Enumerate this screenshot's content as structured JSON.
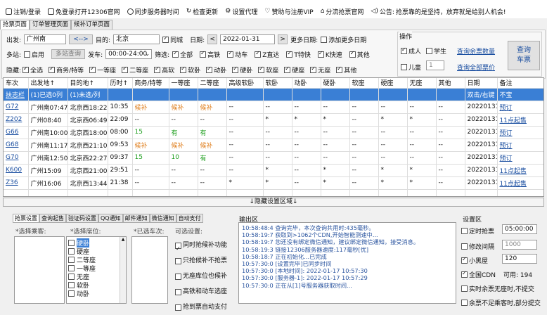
{
  "toolbar": {
    "items": [
      {
        "label": "注销/登录",
        "icon": "screen-icon"
      },
      {
        "label": "免登录打开12306官网",
        "icon": "monitor-icon"
      },
      {
        "label": "同步服务器时间",
        "icon": "clock-icon"
      },
      {
        "label": "检查更新",
        "icon": "refresh-icon"
      },
      {
        "label": "设置代理",
        "icon": "gear-icon"
      },
      {
        "label": "赞助与注册VIP",
        "icon": "heart-icon"
      },
      {
        "label": "分流抢票官网",
        "icon": "home-icon"
      }
    ],
    "notice_label": "公告:",
    "notice_text": "抢票靠的是坚持，放弃就是给别人机会!"
  },
  "tabs": [
    "抢票页面",
    "订单管理页面",
    "候补订单页面"
  ],
  "query": {
    "from_label": "出发:",
    "from": "广州南",
    "swap": "<-->",
    "to_label": "目的:",
    "to": "北京",
    "same_city": "同城",
    "date_label": "日期:",
    "date": "2022-01-31",
    "prev": "<",
    "next": ">",
    "more_dates": "更多日期:",
    "add_more_dates": "添加更多日期",
    "multi_station": "多站:",
    "enable": "启用",
    "multi_query": "多站查询",
    "depart_label": "发车:",
    "depart_time": "00:00-24:00",
    "filter_label": "筛选:",
    "filters": [
      "全部",
      "高铁",
      "动车",
      "Z直达",
      "T特快",
      "K快速",
      "其他"
    ],
    "hide_label": "隐藏:",
    "hide_items": [
      "全选",
      "商务/特等",
      "一等座",
      "二等座",
      "高软",
      "软卧",
      "动卧",
      "硬卧",
      "软座",
      "硬座",
      "无座",
      "其他"
    ]
  },
  "ops": {
    "title": "操作",
    "adult": "成人",
    "student": "学生",
    "child": "儿童",
    "child_count": "1",
    "query_remain": "查询余票数量",
    "query_all": "查询全部票价",
    "search_btn_1": "查询",
    "search_btn_2": "车票"
  },
  "table": {
    "headers": [
      "车次",
      "出发地↑",
      "目的地↑",
      "历时↑",
      "商务/特等",
      "一等座",
      "二等座",
      "高级软卧",
      "软卧",
      "动卧",
      "硬卧",
      "软座",
      "硬座",
      "无座",
      "其他",
      "日期",
      "备注"
    ],
    "select_row": {
      "c0": "扶志栏",
      "c1": "(1)已选0列",
      "c2": "(1)未选/列",
      "c15": "双击/右键",
      "c16": "不宝"
    },
    "rows": [
      {
        "c": [
          "G72",
          "广州南07:47",
          "北京西18:22",
          "10:35",
          "候补",
          "候补",
          "候补",
          "--",
          "--",
          "--",
          "--",
          "--",
          "--",
          "--",
          "--",
          "20220131",
          "预订"
        ],
        "cls": [
          "lnk",
          "",
          "",
          "",
          "orange",
          "orange",
          "orange",
          "",
          "",
          "",
          "",
          "",
          "",
          "",
          "",
          "",
          "lnk"
        ]
      },
      {
        "c": [
          "Z202",
          "广州08:40",
          "北京西06:49",
          "22:09",
          "--",
          "--",
          "--",
          "--",
          "*",
          "*",
          "*",
          "--",
          "*",
          "*",
          "--",
          "20220131",
          "11点起售"
        ],
        "cls": [
          "lnk",
          "",
          "",
          "",
          "",
          "",
          "",
          "",
          "",
          "",
          "",
          "",
          "",
          "",
          "",
          "",
          "lnk"
        ]
      },
      {
        "c": [
          "G66",
          "广州南10:00",
          "北京西18:00",
          "08:00",
          "15",
          "有",
          "有",
          "--",
          "--",
          "--",
          "--",
          "--",
          "--",
          "--",
          "--",
          "20220131",
          "预订"
        ],
        "cls": [
          "lnk",
          "",
          "",
          "",
          "green",
          "green",
          "green",
          "",
          "",
          "",
          "",
          "",
          "",
          "",
          "",
          "",
          "lnk"
        ]
      },
      {
        "c": [
          "G68",
          "广州南11:17",
          "北京西21:10",
          "09:53",
          "候补",
          "候补",
          "候补",
          "--",
          "--",
          "--",
          "--",
          "--",
          "--",
          "--",
          "--",
          "20220131",
          "预订"
        ],
        "cls": [
          "lnk",
          "",
          "",
          "",
          "orange",
          "orange",
          "orange",
          "",
          "",
          "",
          "",
          "",
          "",
          "",
          "",
          "",
          "lnk"
        ]
      },
      {
        "c": [
          "G70",
          "广州南12:50",
          "北京西22:27",
          "09:37",
          "15",
          "10",
          "有",
          "--",
          "--",
          "--",
          "--",
          "--",
          "--",
          "--",
          "--",
          "20220131",
          "预订"
        ],
        "cls": [
          "lnk",
          "",
          "",
          "",
          "green",
          "green",
          "green",
          "",
          "",
          "",
          "",
          "",
          "",
          "",
          "",
          "",
          "lnk"
        ]
      },
      {
        "c": [
          "K600",
          "广州15:09",
          "北京西21:00",
          "29:51",
          "--",
          "--",
          "--",
          "--",
          "*",
          "--",
          "*",
          "--",
          "*",
          "*",
          "--",
          "20220131",
          "11点起售"
        ],
        "cls": [
          "lnk",
          "",
          "",
          "",
          "",
          "",
          "",
          "",
          "",
          "",
          "",
          "",
          "",
          "",
          "",
          "",
          "lnk"
        ]
      },
      {
        "c": [
          "Z36",
          "广州16:06",
          "北京西13:44",
          "21:38",
          "--",
          "--",
          "--",
          "*",
          "*",
          "--",
          "*",
          "--",
          "*",
          "*",
          "--",
          "20220131",
          "11点起售"
        ],
        "cls": [
          "lnk",
          "",
          "",
          "",
          "",
          "",
          "",
          "",
          "",
          "",
          "",
          "",
          "",
          "",
          "",
          "",
          "lnk"
        ]
      }
    ]
  },
  "hide_bar": "↓隐藏设置区域↓",
  "bottom_tabs": [
    "抢票设置",
    "查询起售",
    "验证码设置",
    "QQ通知",
    "邮件通知",
    "微信通知",
    "自动支付"
  ],
  "settings": {
    "passenger_label": "*选择乘客:",
    "seat_label": "*选择席位:",
    "seats": [
      "硬卧",
      "硬座",
      "二等座",
      "一等座",
      "无座",
      "软卧",
      "动卧"
    ],
    "train_label": "*已选车次:",
    "options_label": "可选设置:",
    "options": [
      {
        "label": "同时抢候补功能",
        "on": true
      },
      {
        "label": "只抢候补不抢票",
        "on": false
      },
      {
        "label": "无座库位也候补",
        "on": false
      },
      {
        "label": "高铁和动车选座",
        "on": false
      },
      {
        "label": "抢到票自动支付",
        "on": false
      }
    ]
  },
  "log": {
    "title": "输出区",
    "lines": [
      "10:58:48:4 查询完毕，本次查询共用时:435毫秒。",
      "10:58:19:7 获取到>1062个CDN,开始智能测速中...",
      "10:58:19:7 您还没有绑定微信通知，建议绑定微信通知，接受消息。",
      "10:58:19:3 链接12306服务器速度:117毫秒[优]",
      "10:58:18:7 正在初始化...已完成",
      "10:57:30:0 [设置完毕]已同步时间",
      "10:57:30:0 [本地时间]: 2022-01-17 10:57:30",
      "10:57:30:0 [服务器-1]: 2022-01-17 10:57:29",
      "10:57:30:0 正在从[1]号服务器获取时间..."
    ]
  },
  "setarea": {
    "title": "设置区",
    "timer_label": "定时抢票",
    "timer_value": "05:00:00",
    "interval_label": "修改间隔",
    "interval_value": "1000",
    "blackroom_label": "小黑屋",
    "blackroom_value": "120",
    "cdn_label": "全国CDN",
    "cdn_value": "可用: 194",
    "opt1": "实时余票无座时,不提交",
    "opt2": "余票不足乘客时,部分提交"
  }
}
